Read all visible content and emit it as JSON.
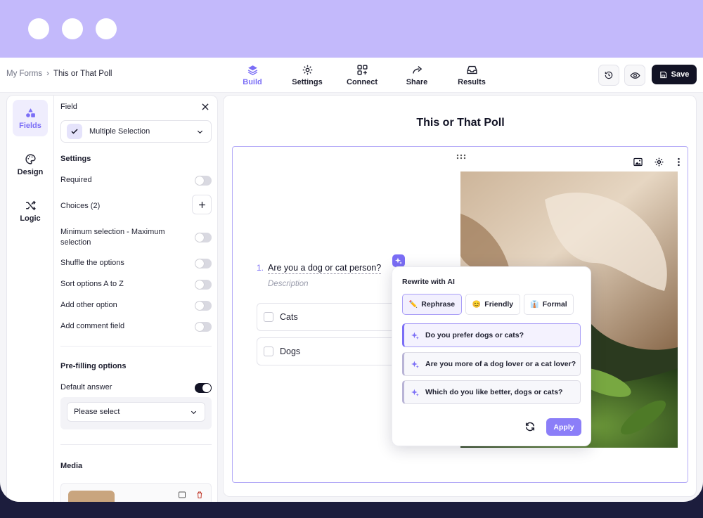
{
  "breadcrumb": {
    "parent": "My Forms",
    "separator": "›",
    "current": "This or That Poll"
  },
  "nav": [
    {
      "label": "Build",
      "icon": "layers-icon"
    },
    {
      "label": "Settings",
      "icon": "gear-icon"
    },
    {
      "label": "Connect",
      "icon": "grid-plus-icon"
    },
    {
      "label": "Share",
      "icon": "share-arrow-icon"
    },
    {
      "label": "Results",
      "icon": "inbox-icon"
    }
  ],
  "toolbar": {
    "save_label": "Save"
  },
  "rail": [
    {
      "label": "Fields",
      "icon": "shapes-icon"
    },
    {
      "label": "Design",
      "icon": "palette-icon"
    },
    {
      "label": "Logic",
      "icon": "shuffle-icon"
    }
  ],
  "panel": {
    "field_label": "Field",
    "field_type": "Multiple Selection",
    "settings_header": "Settings",
    "settings": {
      "required": "Required",
      "choices": "Choices (2)",
      "min_max": "Minimum selection - Maximum selection",
      "shuffle": "Shuffle the options",
      "sort": "Sort options A to Z",
      "other": "Add other option",
      "comment": "Add comment field"
    },
    "prefill_header": "Pre-filling options",
    "default_answer": "Default answer",
    "default_select": "Please select",
    "media_header": "Media"
  },
  "form": {
    "title": "This or That Poll",
    "question_number": "1.",
    "question": "Are you a dog or cat person?",
    "description_placeholder": "Description",
    "choices": [
      "Cats",
      "Dogs"
    ]
  },
  "ai": {
    "title": "Rewrite with AI",
    "tones": [
      {
        "label": "Rephrase",
        "emoji": "✏️"
      },
      {
        "label": "Friendly",
        "emoji": "😊"
      },
      {
        "label": "Formal",
        "emoji": "👔"
      }
    ],
    "suggestions": [
      "Do you prefer dogs or cats?",
      "Are you more of a dog lover or a cat lover?",
      "Which do you like better, dogs or cats?"
    ],
    "apply_label": "Apply"
  },
  "colors": {
    "accent": "#7b6ef6",
    "band": "#c3b9fb",
    "dark": "#121325"
  }
}
